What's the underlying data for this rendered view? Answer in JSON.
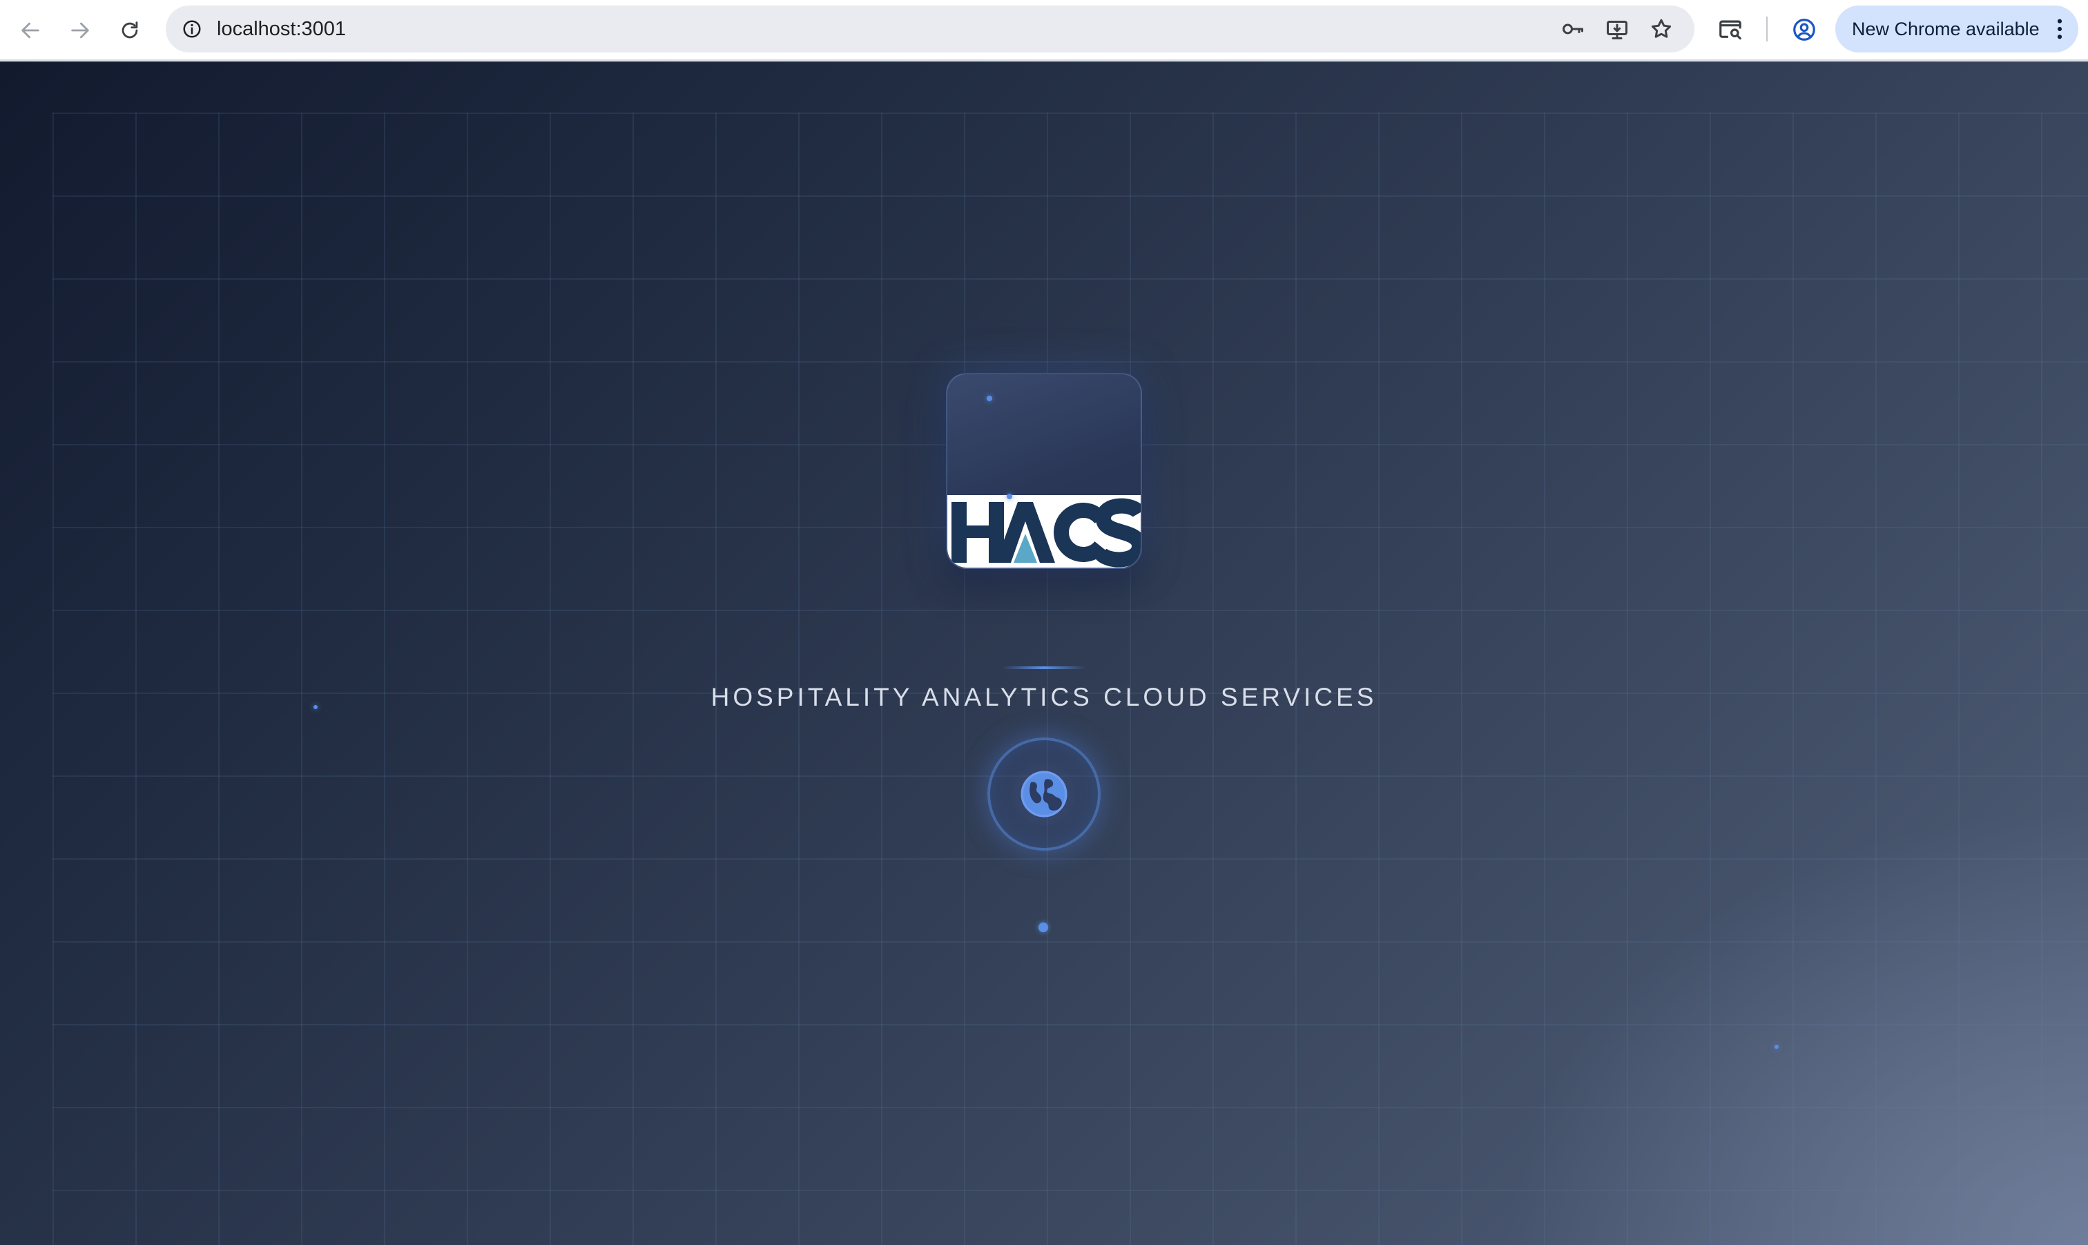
{
  "browser": {
    "url": "localhost:3001",
    "update_label": "New Chrome available",
    "icons": {
      "back": "arrow-left-icon",
      "forward": "arrow-right-icon",
      "reload": "reload-icon",
      "site_info": "info-icon",
      "password": "key-icon",
      "install": "install-app-icon",
      "bookmark": "star-icon",
      "lens": "search-page-icon",
      "profile": "profile-icon",
      "menu": "kebab-menu-icon"
    }
  },
  "page": {
    "logo_text": "HACS",
    "tagline": "HOSPITALITY ANALYTICS CLOUD SERVICES",
    "loader_icon": "globe-icon",
    "colors": {
      "accent": "#5b8fe6",
      "logo_navy": "#1b3557",
      "logo_teal": "#5aa7c7",
      "background_dark": "#121a2e",
      "background_light": "#55627c"
    }
  }
}
